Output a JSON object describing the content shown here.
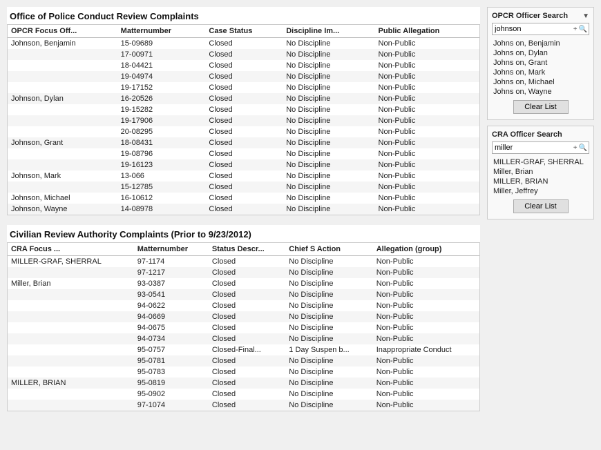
{
  "opcr_section": {
    "title": "Office of Police Conduct Review Complaints",
    "columns": [
      "OPCR Focus Off...",
      "Matternumber",
      "Case Status",
      "Discipline Im...",
      "Public Allegation"
    ],
    "rows": [
      {
        "officer": "Johnson, Benjamin",
        "matter": "15-09689",
        "status": "Closed",
        "discipline": "No Discipline",
        "allegation": "Non-Public"
      },
      {
        "officer": "",
        "matter": "17-00971",
        "status": "Closed",
        "discipline": "No Discipline",
        "allegation": "Non-Public"
      },
      {
        "officer": "",
        "matter": "18-04421",
        "status": "Closed",
        "discipline": "No Discipline",
        "allegation": "Non-Public"
      },
      {
        "officer": "",
        "matter": "19-04974",
        "status": "Closed",
        "discipline": "No Discipline",
        "allegation": "Non-Public"
      },
      {
        "officer": "",
        "matter": "19-17152",
        "status": "Closed",
        "discipline": "No Discipline",
        "allegation": "Non-Public"
      },
      {
        "officer": "Johnson, Dylan",
        "matter": "16-20526",
        "status": "Closed",
        "discipline": "No Discipline",
        "allegation": "Non-Public"
      },
      {
        "officer": "",
        "matter": "19-15282",
        "status": "Closed",
        "discipline": "No Discipline",
        "allegation": "Non-Public"
      },
      {
        "officer": "",
        "matter": "19-17906",
        "status": "Closed",
        "discipline": "No Discipline",
        "allegation": "Non-Public"
      },
      {
        "officer": "",
        "matter": "20-08295",
        "status": "Closed",
        "discipline": "No Discipline",
        "allegation": "Non-Public"
      },
      {
        "officer": "Johnson, Grant",
        "matter": "18-08431",
        "status": "Closed",
        "discipline": "No Discipline",
        "allegation": "Non-Public"
      },
      {
        "officer": "",
        "matter": "19-08796",
        "status": "Closed",
        "discipline": "No Discipline",
        "allegation": "Non-Public"
      },
      {
        "officer": "",
        "matter": "19-16123",
        "status": "Closed",
        "discipline": "No Discipline",
        "allegation": "Non-Public"
      },
      {
        "officer": "Johnson, Mark",
        "matter": "13-066",
        "status": "Closed",
        "discipline": "No Discipline",
        "allegation": "Non-Public"
      },
      {
        "officer": "",
        "matter": "15-12785",
        "status": "Closed",
        "discipline": "No Discipline",
        "allegation": "Non-Public"
      },
      {
        "officer": "Johnson, Michael",
        "matter": "16-10612",
        "status": "Closed",
        "discipline": "No Discipline",
        "allegation": "Non-Public"
      },
      {
        "officer": "Johnson, Wayne",
        "matter": "14-08978",
        "status": "Closed",
        "discipline": "No Discipline",
        "allegation": "Non-Public"
      }
    ]
  },
  "cra_section": {
    "title": "Civilian Review Authority Complaints (Prior to 9/23/2012)",
    "columns": [
      "CRA Focus ...",
      "Matternumber",
      "Status Descr...",
      "Chief S Action",
      "Allegation (group)"
    ],
    "rows": [
      {
        "officer": "MILLER-GRAF, SHERRAL",
        "matter": "97-1174",
        "status": "Closed",
        "action": "No Discipline",
        "allegation": "Non-Public"
      },
      {
        "officer": "",
        "matter": "97-1217",
        "status": "Closed",
        "action": "No Discipline",
        "allegation": "Non-Public"
      },
      {
        "officer": "Miller, Brian",
        "matter": "93-0387",
        "status": "Closed",
        "action": "No Discipline",
        "allegation": "Non-Public"
      },
      {
        "officer": "",
        "matter": "93-0541",
        "status": "Closed",
        "action": "No Discipline",
        "allegation": "Non-Public"
      },
      {
        "officer": "",
        "matter": "94-0622",
        "status": "Closed",
        "action": "No Discipline",
        "allegation": "Non-Public"
      },
      {
        "officer": "",
        "matter": "94-0669",
        "status": "Closed",
        "action": "No Discipline",
        "allegation": "Non-Public"
      },
      {
        "officer": "",
        "matter": "94-0675",
        "status": "Closed",
        "action": "No Discipline",
        "allegation": "Non-Public"
      },
      {
        "officer": "",
        "matter": "94-0734",
        "status": "Closed",
        "action": "No Discipline",
        "allegation": "Non-Public"
      },
      {
        "officer": "",
        "matter": "95-0757",
        "status": "Closed-Final...",
        "action": "1 Day Suspen b...",
        "allegation": "Inappropriate Conduct"
      },
      {
        "officer": "",
        "matter": "95-0781",
        "status": "Closed",
        "action": "No Discipline",
        "allegation": "Non-Public"
      },
      {
        "officer": "",
        "matter": "95-0783",
        "status": "Closed",
        "action": "No Discipline",
        "allegation": "Non-Public"
      },
      {
        "officer": "MILLER, BRIAN",
        "matter": "95-0819",
        "status": "Closed",
        "action": "No Discipline",
        "allegation": "Non-Public"
      },
      {
        "officer": "",
        "matter": "95-0902",
        "status": "Closed",
        "action": "No Discipline",
        "allegation": "Non-Public"
      },
      {
        "officer": "",
        "matter": "97-1074",
        "status": "Closed",
        "action": "No Discipline",
        "allegation": "Non-Public"
      }
    ]
  },
  "sidebar": {
    "opcr_search": {
      "title": "OPCR Officer Search",
      "value": "johnson",
      "results": [
        "Johns on, Benjamin",
        "Johns on, Dylan",
        "Johns on, Grant",
        "Johns on, Mark",
        "Johns on, Michael",
        "Johns on, Wayne"
      ],
      "clear_label": "Clear List"
    },
    "cra_search": {
      "title": "CRA Officer Search",
      "value": "miller",
      "results": [
        "MILLER-GRAF, SHERRAL",
        "Miller, Brian",
        "MILLER, BRIAN",
        "Miller, Jeffrey"
      ],
      "clear_label": "Clear List"
    }
  }
}
